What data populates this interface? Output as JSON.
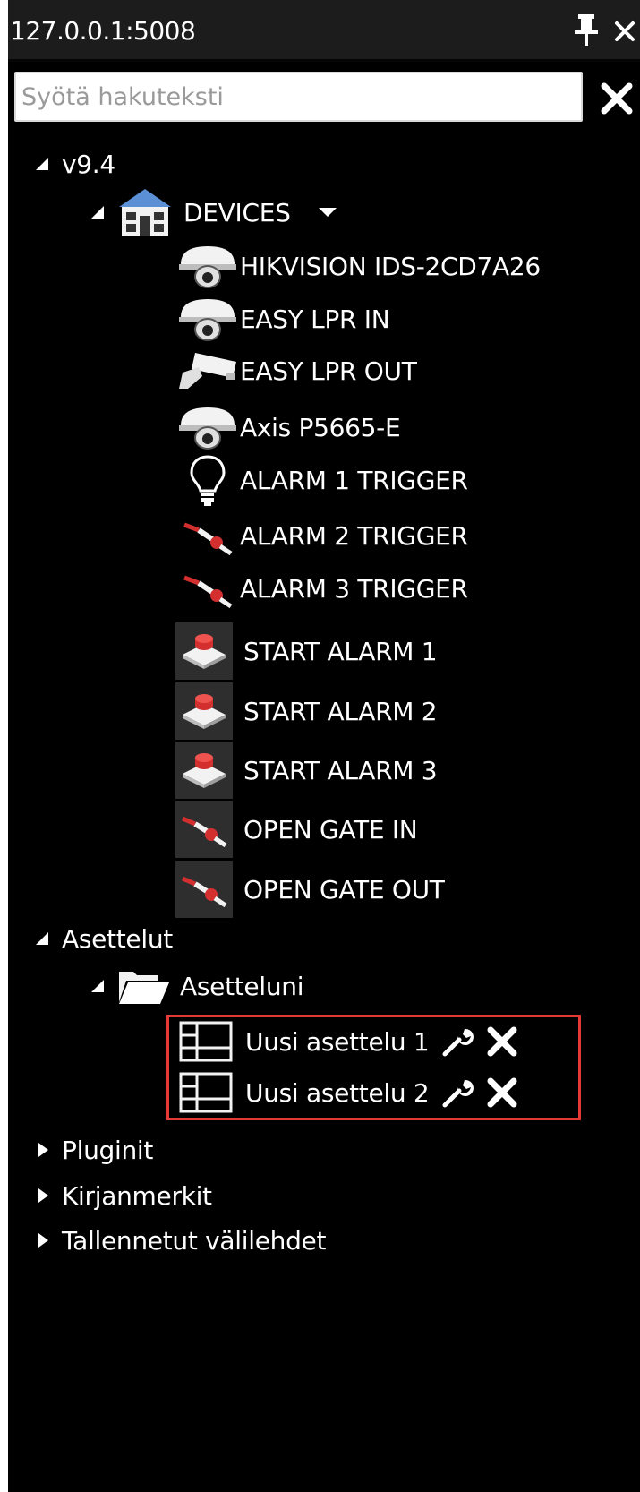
{
  "window": {
    "title": "127.0.0.1:5008",
    "pin_icon": "pin-icon",
    "close_icon": "close-icon"
  },
  "search": {
    "placeholder": "Syötä hakuteksti",
    "value": "",
    "clear_icon": "clear-icon"
  },
  "tree": {
    "root": {
      "label": "v9.4",
      "expanded": true
    },
    "devices": {
      "label": "DEVICES",
      "icon": "building-icon",
      "dropdown_icon": "caret-down-icon",
      "expanded": true,
      "items": [
        {
          "label": "HIKVISION IDS-2CD7A26",
          "icon": "dome-camera-icon"
        },
        {
          "label": "EASY LPR IN",
          "icon": "dome-camera-icon"
        },
        {
          "label": "EASY LPR OUT",
          "icon": "bullet-camera-icon"
        },
        {
          "label": "Axis P5665-E",
          "icon": "dome-camera-icon"
        },
        {
          "label": "ALARM 1 TRIGGER",
          "icon": "lightbulb-icon"
        },
        {
          "label": "ALARM 2 TRIGGER",
          "icon": "switch-icon"
        },
        {
          "label": "ALARM 3 TRIGGER",
          "icon": "switch-icon"
        },
        {
          "label": "START ALARM 1",
          "icon": "push-button-icon"
        },
        {
          "label": "START ALARM 2",
          "icon": "push-button-icon"
        },
        {
          "label": "START ALARM 3",
          "icon": "push-button-icon"
        },
        {
          "label": "OPEN GATE IN",
          "icon": "switch-icon"
        },
        {
          "label": "OPEN GATE OUT",
          "icon": "switch-icon"
        }
      ]
    },
    "layouts": {
      "label": "Asettelut",
      "expanded": true,
      "folder": {
        "label": "Asetteluni",
        "icon": "folder-icon",
        "expanded": true,
        "items": [
          {
            "label": "Uusi asettelu 1",
            "icon": "layout-grid-icon",
            "edit_icon": "wrench-icon",
            "delete_icon": "delete-icon"
          },
          {
            "label": "Uusi asettelu 2",
            "icon": "layout-grid-icon",
            "edit_icon": "wrench-icon",
            "delete_icon": "delete-icon"
          }
        ]
      }
    },
    "collapsed_sections": [
      {
        "label": "Pluginit"
      },
      {
        "label": "Kirjanmerkit"
      },
      {
        "label": "Tallennetut välilehdet"
      }
    ]
  },
  "colors": {
    "panel_bg": "#000000",
    "titlebar_bg": "#1c1c1c",
    "text": "#ffffff",
    "highlight_border": "#e53935",
    "accent_red": "#d32f2f",
    "building_blue": "#5b8fd6"
  }
}
